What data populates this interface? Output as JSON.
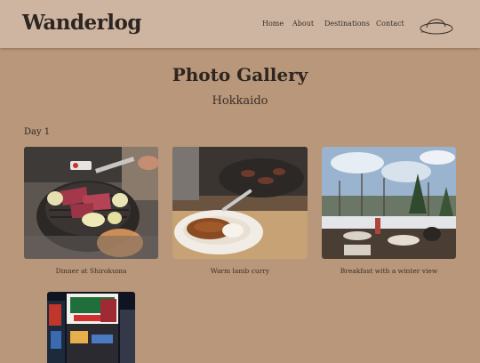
{
  "header": {
    "brand": "Wanderlog",
    "nav": [
      "Home",
      "About",
      "Destinations",
      "Contact"
    ]
  },
  "page": {
    "title": "Photo Gallery",
    "subtitle": "Hokkaido"
  },
  "gallery": {
    "day_label": "Day 1",
    "photos": [
      {
        "caption": "Dinner at Shirokuma"
      },
      {
        "caption": "Warm lamb curry"
      },
      {
        "caption": "Breakfast with a winter view"
      },
      {
        "caption": ""
      }
    ]
  },
  "colors": {
    "background": "#b8977a",
    "header": "#cdb5a1",
    "text": "#2e2520"
  }
}
